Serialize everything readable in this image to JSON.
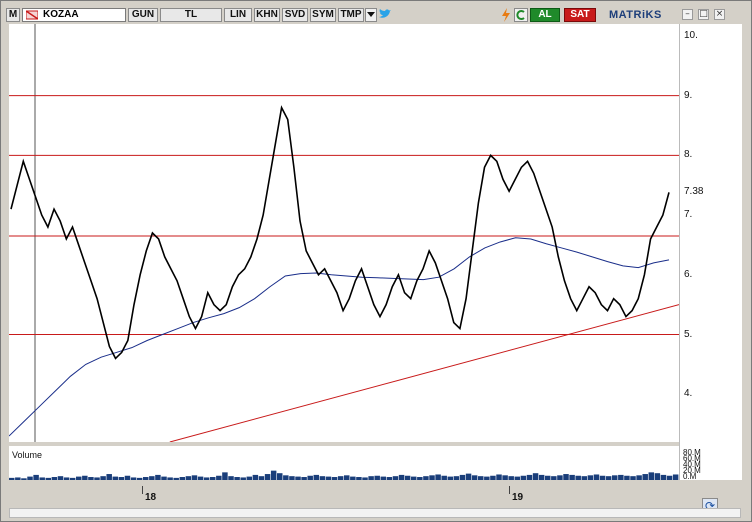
{
  "toolbar": {
    "menu_icon_label": "M",
    "symbol": "KOZAA",
    "buttons": [
      "GUN",
      "TL",
      "LIN",
      "KHN",
      "SVD",
      "SYM",
      "TMP"
    ],
    "buy_label": "AL",
    "sell_label": "SAT",
    "brand": "MATRiKS",
    "colors": {
      "buy": "#1f8a2a",
      "sell": "#c81a1a",
      "brand": "#1d3e7a"
    }
  },
  "price_axis": {
    "ticks": [
      "10.",
      "9.",
      "8.",
      "7.",
      "6.",
      "5.",
      "4."
    ],
    "last_price": "7.38"
  },
  "volume": {
    "label": "Volume",
    "scale": [
      "80.M",
      "60.M",
      "40.M",
      "20.M",
      "0.M"
    ]
  },
  "date_axis": {
    "ticks": [
      "18",
      "19"
    ]
  },
  "chart_data": {
    "type": "line",
    "ylim": [
      3.2,
      10.2
    ],
    "horizontal_lines": [
      9.0,
      8.0,
      6.65,
      5.0
    ],
    "colors": {
      "price": "#000000",
      "moving_average": "#1a2e8a",
      "support": "#c81a1a",
      "volume": "#1a3e7a"
    },
    "close": [
      7.1,
      7.5,
      7.9,
      7.6,
      7.3,
      7.0,
      6.8,
      7.1,
      6.9,
      6.6,
      6.8,
      6.5,
      6.2,
      5.9,
      5.6,
      5.2,
      4.8,
      4.6,
      4.7,
      4.9,
      5.5,
      6.0,
      6.4,
      6.7,
      6.6,
      6.3,
      6.1,
      5.9,
      5.6,
      5.3,
      5.1,
      5.3,
      5.7,
      5.5,
      5.4,
      5.5,
      5.8,
      6.0,
      6.1,
      6.3,
      6.6,
      7.0,
      7.6,
      8.2,
      8.8,
      8.6,
      7.8,
      6.9,
      6.4,
      6.2,
      6.0,
      6.1,
      5.9,
      5.7,
      5.4,
      5.6,
      5.9,
      6.1,
      5.8,
      5.5,
      5.3,
      5.5,
      5.8,
      6.0,
      5.7,
      5.6,
      5.9,
      6.1,
      6.4,
      6.2,
      5.9,
      5.6,
      5.2,
      5.1,
      5.6,
      6.4,
      7.2,
      7.8,
      8.0,
      7.9,
      7.6,
      7.4,
      7.6,
      7.8,
      7.9,
      7.7,
      7.4,
      7.1,
      6.8,
      6.3,
      5.9,
      5.6,
      5.4,
      5.6,
      5.8,
      5.7,
      5.5,
      5.4,
      5.6,
      5.5,
      5.3,
      5.4,
      5.6,
      6.0,
      6.6,
      6.8,
      7.0,
      7.38
    ],
    "moving_average": [
      3.3,
      3.55,
      3.8,
      4.05,
      4.3,
      4.5,
      4.62,
      4.7,
      4.78,
      4.9,
      5.0,
      5.1,
      5.2,
      5.28,
      5.35,
      5.45,
      5.6,
      5.8,
      5.98,
      6.02,
      6.03,
      6.0,
      5.98,
      5.96,
      5.95,
      5.94,
      5.93,
      5.92,
      5.96,
      6.1,
      6.3,
      6.45,
      6.55,
      6.62,
      6.6,
      6.52,
      6.45,
      6.38,
      6.3,
      6.22,
      6.15,
      6.12,
      6.2,
      6.25
    ],
    "support_line": {
      "start": [
        0.24,
        3.2
      ],
      "end": [
        1.0,
        5.5
      ]
    },
    "volume": [
      5,
      6,
      4,
      8,
      12,
      6,
      5,
      7,
      9,
      6,
      5,
      8,
      10,
      7,
      6,
      9,
      14,
      8,
      7,
      10,
      6,
      5,
      7,
      9,
      12,
      8,
      6,
      5,
      7,
      9,
      11,
      8,
      6,
      7,
      10,
      18,
      9,
      7,
      6,
      8,
      12,
      9,
      14,
      22,
      16,
      11,
      9,
      8,
      7,
      10,
      12,
      9,
      8,
      7,
      9,
      11,
      8,
      7,
      6,
      9,
      10,
      8,
      7,
      9,
      12,
      10,
      8,
      7,
      9,
      11,
      13,
      10,
      8,
      9,
      12,
      15,
      11,
      9,
      8,
      10,
      13,
      11,
      9,
      8,
      10,
      12,
      16,
      12,
      10,
      9,
      11,
      14,
      12,
      10,
      9,
      11,
      13,
      10,
      9,
      11,
      12,
      10,
      9,
      11,
      14,
      18,
      16,
      12,
      10,
      13
    ]
  }
}
